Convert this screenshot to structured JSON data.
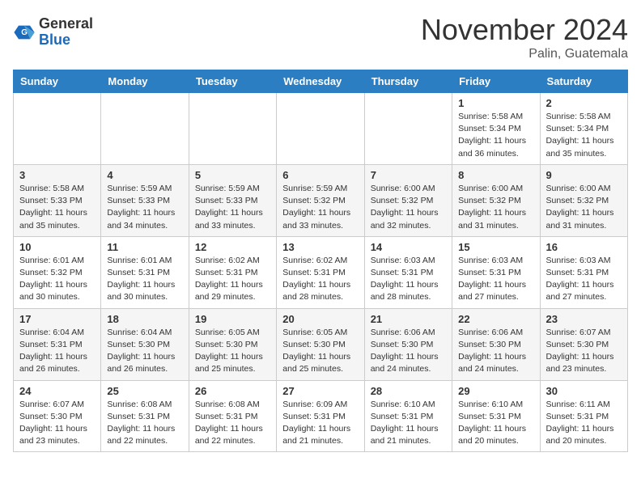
{
  "header": {
    "logo_general": "General",
    "logo_blue": "Blue",
    "month_title": "November 2024",
    "location": "Palin, Guatemala"
  },
  "days_of_week": [
    "Sunday",
    "Monday",
    "Tuesday",
    "Wednesday",
    "Thursday",
    "Friday",
    "Saturday"
  ],
  "weeks": [
    [
      {
        "day": "",
        "info": ""
      },
      {
        "day": "",
        "info": ""
      },
      {
        "day": "",
        "info": ""
      },
      {
        "day": "",
        "info": ""
      },
      {
        "day": "",
        "info": ""
      },
      {
        "day": "1",
        "info": "Sunrise: 5:58 AM\nSunset: 5:34 PM\nDaylight: 11 hours\nand 36 minutes."
      },
      {
        "day": "2",
        "info": "Sunrise: 5:58 AM\nSunset: 5:34 PM\nDaylight: 11 hours\nand 35 minutes."
      }
    ],
    [
      {
        "day": "3",
        "info": "Sunrise: 5:58 AM\nSunset: 5:33 PM\nDaylight: 11 hours\nand 35 minutes."
      },
      {
        "day": "4",
        "info": "Sunrise: 5:59 AM\nSunset: 5:33 PM\nDaylight: 11 hours\nand 34 minutes."
      },
      {
        "day": "5",
        "info": "Sunrise: 5:59 AM\nSunset: 5:33 PM\nDaylight: 11 hours\nand 33 minutes."
      },
      {
        "day": "6",
        "info": "Sunrise: 5:59 AM\nSunset: 5:32 PM\nDaylight: 11 hours\nand 33 minutes."
      },
      {
        "day": "7",
        "info": "Sunrise: 6:00 AM\nSunset: 5:32 PM\nDaylight: 11 hours\nand 32 minutes."
      },
      {
        "day": "8",
        "info": "Sunrise: 6:00 AM\nSunset: 5:32 PM\nDaylight: 11 hours\nand 31 minutes."
      },
      {
        "day": "9",
        "info": "Sunrise: 6:00 AM\nSunset: 5:32 PM\nDaylight: 11 hours\nand 31 minutes."
      }
    ],
    [
      {
        "day": "10",
        "info": "Sunrise: 6:01 AM\nSunset: 5:32 PM\nDaylight: 11 hours\nand 30 minutes."
      },
      {
        "day": "11",
        "info": "Sunrise: 6:01 AM\nSunset: 5:31 PM\nDaylight: 11 hours\nand 30 minutes."
      },
      {
        "day": "12",
        "info": "Sunrise: 6:02 AM\nSunset: 5:31 PM\nDaylight: 11 hours\nand 29 minutes."
      },
      {
        "day": "13",
        "info": "Sunrise: 6:02 AM\nSunset: 5:31 PM\nDaylight: 11 hours\nand 28 minutes."
      },
      {
        "day": "14",
        "info": "Sunrise: 6:03 AM\nSunset: 5:31 PM\nDaylight: 11 hours\nand 28 minutes."
      },
      {
        "day": "15",
        "info": "Sunrise: 6:03 AM\nSunset: 5:31 PM\nDaylight: 11 hours\nand 27 minutes."
      },
      {
        "day": "16",
        "info": "Sunrise: 6:03 AM\nSunset: 5:31 PM\nDaylight: 11 hours\nand 27 minutes."
      }
    ],
    [
      {
        "day": "17",
        "info": "Sunrise: 6:04 AM\nSunset: 5:31 PM\nDaylight: 11 hours\nand 26 minutes."
      },
      {
        "day": "18",
        "info": "Sunrise: 6:04 AM\nSunset: 5:30 PM\nDaylight: 11 hours\nand 26 minutes."
      },
      {
        "day": "19",
        "info": "Sunrise: 6:05 AM\nSunset: 5:30 PM\nDaylight: 11 hours\nand 25 minutes."
      },
      {
        "day": "20",
        "info": "Sunrise: 6:05 AM\nSunset: 5:30 PM\nDaylight: 11 hours\nand 25 minutes."
      },
      {
        "day": "21",
        "info": "Sunrise: 6:06 AM\nSunset: 5:30 PM\nDaylight: 11 hours\nand 24 minutes."
      },
      {
        "day": "22",
        "info": "Sunrise: 6:06 AM\nSunset: 5:30 PM\nDaylight: 11 hours\nand 24 minutes."
      },
      {
        "day": "23",
        "info": "Sunrise: 6:07 AM\nSunset: 5:30 PM\nDaylight: 11 hours\nand 23 minutes."
      }
    ],
    [
      {
        "day": "24",
        "info": "Sunrise: 6:07 AM\nSunset: 5:30 PM\nDaylight: 11 hours\nand 23 minutes."
      },
      {
        "day": "25",
        "info": "Sunrise: 6:08 AM\nSunset: 5:31 PM\nDaylight: 11 hours\nand 22 minutes."
      },
      {
        "day": "26",
        "info": "Sunrise: 6:08 AM\nSunset: 5:31 PM\nDaylight: 11 hours\nand 22 minutes."
      },
      {
        "day": "27",
        "info": "Sunrise: 6:09 AM\nSunset: 5:31 PM\nDaylight: 11 hours\nand 21 minutes."
      },
      {
        "day": "28",
        "info": "Sunrise: 6:10 AM\nSunset: 5:31 PM\nDaylight: 11 hours\nand 21 minutes."
      },
      {
        "day": "29",
        "info": "Sunrise: 6:10 AM\nSunset: 5:31 PM\nDaylight: 11 hours\nand 20 minutes."
      },
      {
        "day": "30",
        "info": "Sunrise: 6:11 AM\nSunset: 5:31 PM\nDaylight: 11 hours\nand 20 minutes."
      }
    ]
  ]
}
